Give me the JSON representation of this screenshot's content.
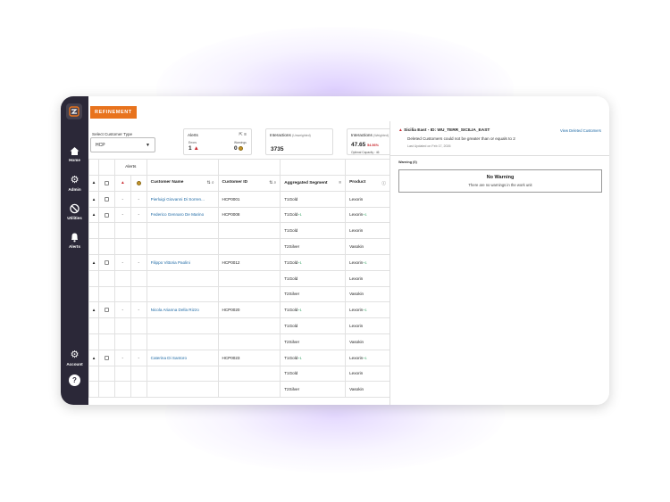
{
  "nav": {
    "items": [
      {
        "label": "Home",
        "icon": "home-icon"
      },
      {
        "label": "Admin",
        "icon": "gear-icon"
      },
      {
        "label": "Utilities",
        "icon": "utilities-icon"
      },
      {
        "label": "Alerts",
        "icon": "bell-icon"
      }
    ],
    "account_label": "Account",
    "help_label": "?"
  },
  "tab": "REFINEMENT",
  "customer_type": {
    "label": "Select Customer Type",
    "value": "HCP"
  },
  "cards": {
    "alerts": {
      "title": "Alerts",
      "errors_label": "Errors",
      "errors_value": "1",
      "warnings_label": "Warnings",
      "warnings_value": "0"
    },
    "interactions_unweighted": {
      "title": "Interactions",
      "qualifier": "(Unweighted)",
      "value": "3735"
    },
    "interactions_weighted": {
      "title": "Interactions",
      "qualifier": "(Weighted)",
      "value": "47.65",
      "pct": "54.56%",
      "sub": "Optimal Capacity : 46"
    }
  },
  "table": {
    "alerts_group": "Alerts",
    "headers": {
      "name": "Customer Name",
      "id": "Customer ID",
      "segment": "Aggregated Segment",
      "product": "Product"
    },
    "rows": [
      {
        "caret": "▲",
        "e": "-",
        "w": "-",
        "name": "Pierluigi Giovanni Di Sorren...",
        "id": "HCP0001",
        "segment": "T1Gold",
        "seg_plus": "",
        "product": "Lexorin",
        "prod_plus": ""
      },
      {
        "caret": "▲",
        "e": "-",
        "w": "-",
        "name": "Federico Gennaro De Marino",
        "id": "HCP0008",
        "segment": "T1Gold",
        "seg_plus": "+1",
        "product": "Lexorin",
        "prod_plus": "+1"
      },
      {
        "caret": "",
        "e": "",
        "w": "",
        "name": "",
        "id": "",
        "segment": "T1Gold",
        "seg_plus": "",
        "product": "Lexorin",
        "prod_plus": ""
      },
      {
        "caret": "",
        "e": "",
        "w": "",
        "name": "",
        "id": "",
        "segment": "T2Silver",
        "seg_plus": "",
        "product": "Vasokin",
        "prod_plus": ""
      },
      {
        "caret": "▲",
        "e": "-",
        "w": "-",
        "name": "Filippo Vittoria Paolini",
        "id": "HCP0012",
        "segment": "T1Gold",
        "seg_plus": "+1",
        "product": "Lexorin",
        "prod_plus": "+1"
      },
      {
        "caret": "",
        "e": "",
        "w": "",
        "name": "",
        "id": "",
        "segment": "T1Gold",
        "seg_plus": "",
        "product": "Lexorin",
        "prod_plus": ""
      },
      {
        "caret": "",
        "e": "",
        "w": "",
        "name": "",
        "id": "",
        "segment": "T2Silver",
        "seg_plus": "",
        "product": "Vasokin",
        "prod_plus": ""
      },
      {
        "caret": "▲",
        "e": "-",
        "w": "-",
        "name": "Nicola Arianna Della Rizzo",
        "id": "HCP0020",
        "segment": "T1Gold",
        "seg_plus": "+1",
        "product": "Lexorin",
        "prod_plus": "+1"
      },
      {
        "caret": "",
        "e": "",
        "w": "",
        "name": "",
        "id": "",
        "segment": "T1Gold",
        "seg_plus": "",
        "product": "Lexorin",
        "prod_plus": ""
      },
      {
        "caret": "",
        "e": "",
        "w": "",
        "name": "",
        "id": "",
        "segment": "T2Silver",
        "seg_plus": "",
        "product": "Vasokin",
        "prod_plus": ""
      },
      {
        "caret": "▲",
        "e": "-",
        "w": "-",
        "name": "Caterina Di Santoro",
        "id": "HCP0023",
        "segment": "T1Gold",
        "seg_plus": "+1",
        "product": "Lexorin",
        "prod_plus": "+1"
      },
      {
        "caret": "",
        "e": "",
        "w": "",
        "name": "",
        "id": "",
        "segment": "T1Gold",
        "seg_plus": "",
        "product": "Lexorin",
        "prod_plus": ""
      },
      {
        "caret": "",
        "e": "",
        "w": "",
        "name": "",
        "id": "",
        "segment": "T2Silver",
        "seg_plus": "",
        "product": "Vasokin",
        "prod_plus": ""
      }
    ]
  },
  "panel": {
    "title": "Sicilia East - ID: WU_TERR_SICILIA_EAST",
    "message": "Deleted Customers could not be greater than or equals to 2",
    "updated": "Last Updated on Feb 17, 2026",
    "view_deleted": "View Deleted Customers",
    "warning_count": "Warning (0)",
    "no_warning_title": "No Warning",
    "no_warning_text": "There are no warnings in the work unit"
  },
  "colors": {
    "sidebar": "#2b2838",
    "accent": "#e8731d",
    "link": "#1f6aa5",
    "error": "#c9272d"
  }
}
